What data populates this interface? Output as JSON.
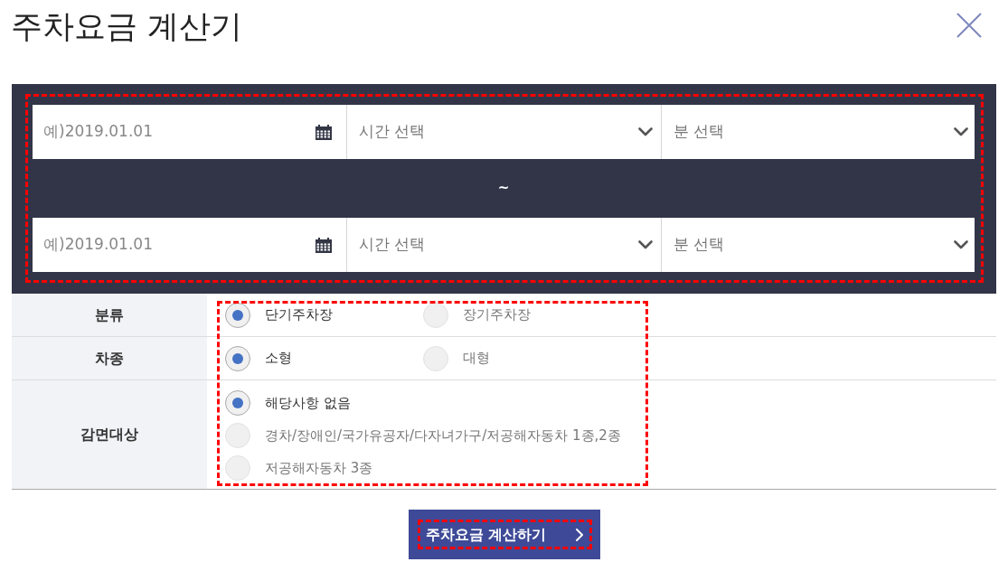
{
  "title": "주차요금 계산기",
  "date_range": {
    "highlighted": true,
    "start": {
      "date": {
        "placeholder": "예)2019.01.01"
      },
      "hour": {
        "value": "시간 선택"
      },
      "minute": {
        "value": "분 선택"
      }
    },
    "separator": "~",
    "end": {
      "date": {
        "placeholder": "예)2019.01.01"
      },
      "hour": {
        "value": "시간 선택"
      },
      "minute": {
        "value": "분 선택"
      }
    }
  },
  "options": {
    "highlighted": true,
    "rows": [
      {
        "label": "분류",
        "kind": "inline",
        "choices": [
          {
            "label": "단기주차장",
            "selected": true
          },
          {
            "label": "장기주차장",
            "selected": false
          }
        ]
      },
      {
        "label": "차종",
        "kind": "inline",
        "choices": [
          {
            "label": "소형",
            "selected": true
          },
          {
            "label": "대형",
            "selected": false
          }
        ]
      },
      {
        "label": "감면대상",
        "kind": "stacked",
        "choices": [
          {
            "label": "해당사항 없음",
            "selected": true
          },
          {
            "label": "경차/장애인/국가유공자/다자녀가구/저공해자동차 1종,2종",
            "selected": false
          },
          {
            "label": "저공해자동차 3종",
            "selected": false
          }
        ]
      }
    ]
  },
  "submit_button": {
    "label": "주차요금 계산하기",
    "highlighted": true
  }
}
